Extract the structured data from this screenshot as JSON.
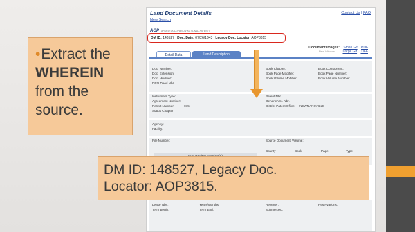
{
  "page": {
    "title": "Land Document Details",
    "links": [
      "Contact Us",
      "FAQ"
    ],
    "link_sep": "|",
    "new_search": "New Search",
    "aop_code": "AOP",
    "aop_desc": "ARMED OCCUPATION ACT LAND PATENTS",
    "dm_id_label": "DM ID:",
    "dm_id": "148527",
    "doc_date_label": "Doc. Date:",
    "doc_date": "07/26/1843",
    "locator_label": "Legacy Doc. Locator:",
    "locator": "AOP3815",
    "doc_images_label": "Document Images:",
    "new_window": "New Window",
    "img_links": [
      "Small Gif",
      "PDF",
      "Large Gif",
      "TIFF"
    ],
    "tabs": [
      "Detail Data",
      "Land Description"
    ]
  },
  "fields": {
    "doc_number": "Doc. Number:",
    "doc_extension": "Doc. Extension:",
    "doc_modifier": "Doc. Modifier:",
    "dro_deed": "DRO Deed Nbr:",
    "book_chapter": "Book Chapter:",
    "book_page_mod": "Book Page Modifier:",
    "book_vol_mod": "Book Volume Modifier:",
    "book_component": "Book Component:",
    "book_page_number": "Book Page Number:",
    "book_vol_number": "Book Volume Number:",
    "instrument_type": "Instrument Type:",
    "agreement_number": "Agreement Number:",
    "permit_number": "Permit Number:",
    "permit_value": "815",
    "status_chapter": "Status Chapter:",
    "patent_nbr": "Patent Nbr.:",
    "generic_vol": "Generic Vol. Nbr.:",
    "district_office": "District Patent Office:",
    "district_value": "NEWNANSVILLE",
    "agency": "Agency:",
    "facility": "Facility:",
    "file_number": "File Number:",
    "source_doc_vol": "Source Document Volume:",
    "bla_review": "BLA Review Number(s)",
    "cols": [
      "County",
      "Book",
      "Page",
      "Type"
    ],
    "lease_nbr": "Lease Nbr.:",
    "years_months": "Years/Months:",
    "reverter": "Reverter:",
    "reservations": "Reservations:",
    "term_begin": "Term Begin:",
    "term_end": "Term End:",
    "submerged": "Submerged:"
  },
  "callout_left": {
    "line1": "Extract the",
    "line2": "WHEREIN",
    "line3": "from the",
    "line4": "source."
  },
  "callout_bottom": {
    "line1": "DM ID: 148527, Legacy Doc.",
    "line2": "Locator: AOP3815."
  },
  "colors": {
    "accent_orange": "#f0a030",
    "callout_fill": "#f6c999",
    "highlight_red": "#d9281e",
    "link_blue": "#2a4fa8"
  }
}
